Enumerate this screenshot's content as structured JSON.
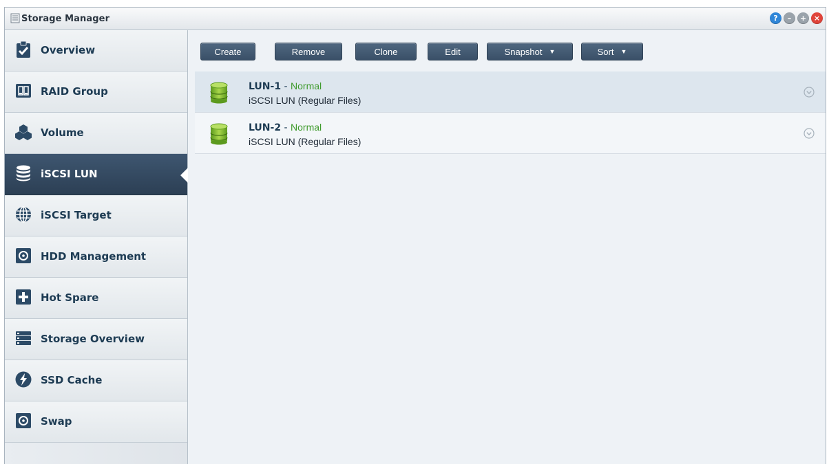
{
  "window": {
    "title": "Storage Manager"
  },
  "title_controls": [
    {
      "name": "help-icon",
      "glyph": "?",
      "color": "#2f86d8"
    },
    {
      "name": "minimize-icon",
      "glyph": "–",
      "color": "#9aa3ab"
    },
    {
      "name": "maximize-icon",
      "glyph": "+",
      "color": "#9aa3ab"
    },
    {
      "name": "close-icon",
      "glyph": "×",
      "color": "#e0443a"
    }
  ],
  "sidebar": {
    "active_index": 3,
    "items": [
      {
        "label": "Overview",
        "icon": "overview-clipboard-icon"
      },
      {
        "label": "RAID Group",
        "icon": "raid-group-icon"
      },
      {
        "label": "Volume",
        "icon": "volume-cubes-icon"
      },
      {
        "label": "iSCSI LUN",
        "icon": "database-icon"
      },
      {
        "label": "iSCSI Target",
        "icon": "globe-icon"
      },
      {
        "label": "HDD Management",
        "icon": "hdd-icon"
      },
      {
        "label": "Hot Spare",
        "icon": "hot-spare-plus-icon"
      },
      {
        "label": "Storage Overview",
        "icon": "storage-stack-icon"
      },
      {
        "label": "SSD Cache",
        "icon": "lightning-icon"
      },
      {
        "label": "Swap",
        "icon": "swap-disk-icon"
      }
    ]
  },
  "toolbar": {
    "create": "Create",
    "remove": "Remove",
    "clone": "Clone",
    "edit": "Edit",
    "snapshot": "Snapshot",
    "sort": "Sort"
  },
  "luns": [
    {
      "name": "LUN-1",
      "separator": " - ",
      "status": "Normal",
      "type": "iSCSI LUN (Regular Files)",
      "selected": true
    },
    {
      "name": "LUN-2",
      "separator": " - ",
      "status": "Normal",
      "type": "iSCSI LUN (Regular Files)",
      "selected": false
    }
  ],
  "colors": {
    "status_ok": "#3e9a2c",
    "accent": "#2c3f54"
  }
}
